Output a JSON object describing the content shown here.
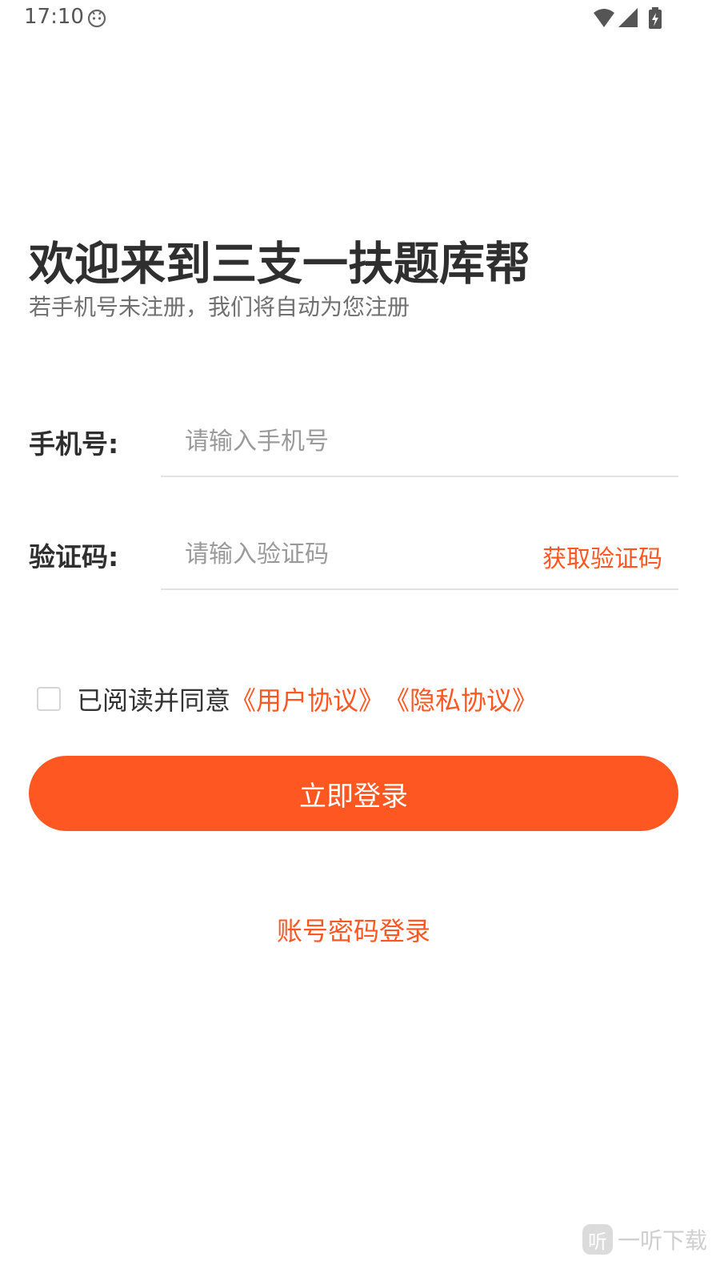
{
  "status_bar": {
    "time": "17:10"
  },
  "header": {
    "title": "欢迎来到三支一扶题库帮",
    "subtitle": "若手机号未注册，我们将自动为您注册"
  },
  "form": {
    "phone": {
      "label": "手机号:",
      "placeholder": "请输入手机号",
      "value": ""
    },
    "code": {
      "label": "验证码:",
      "placeholder": "请输入验证码",
      "value": "",
      "get_code_label": "获取验证码"
    }
  },
  "agreement": {
    "checked": false,
    "text": "已阅读并同意",
    "user_agreement": "《用户协议》",
    "privacy_policy": "《隐私协议》"
  },
  "actions": {
    "login_label": "立即登录",
    "password_login_label": "账号密码登录"
  },
  "watermark": {
    "logo_char": "听",
    "text": "一听下载"
  },
  "colors": {
    "accent": "#ff5722",
    "text_primary": "#2f2f2f",
    "text_secondary": "#707070",
    "placeholder": "#9a9a9a",
    "divider": "#e2e2e2"
  },
  "icons": {
    "status_face": "android-face-icon",
    "wifi": "wifi-icon",
    "signal": "cellular-signal-icon",
    "battery": "battery-charging-icon"
  }
}
